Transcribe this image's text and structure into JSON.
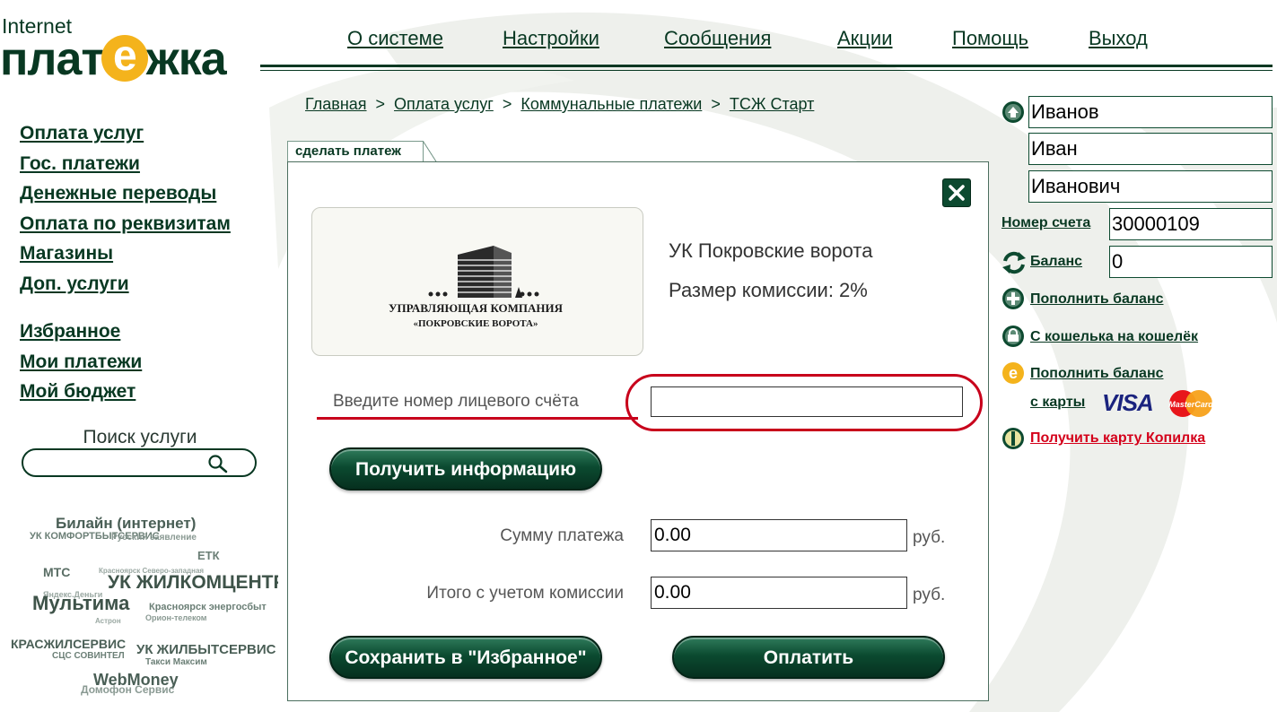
{
  "logo": {
    "line1": "Internet",
    "line2_pre": "плат",
    "line2_badge": "е",
    "line2_post": "жка"
  },
  "top_menu": [
    {
      "label": "О системе"
    },
    {
      "label": "Настройки"
    },
    {
      "label": "Сообщения"
    },
    {
      "label": "Акции"
    },
    {
      "label": "Помощь"
    },
    {
      "label": "Выход"
    }
  ],
  "breadcrumb": {
    "items": [
      "Главная",
      "Оплата услуг",
      "Коммунальные платежи",
      "ТСЖ Старт"
    ],
    "separator": ">"
  },
  "left_nav": {
    "group1": [
      "Оплата услуг",
      "Гос. платежи",
      "Денежные переводы",
      "Оплата по реквизитам",
      "Магазины",
      "Доп. услуги"
    ],
    "group2": [
      "Избранное",
      "Мои платежи",
      "Мой бюджет"
    ]
  },
  "search": {
    "label": "Поиск услуги",
    "value": ""
  },
  "tag_cloud": [
    {
      "text": "Билайн (интернет)",
      "size": 17,
      "color": "#4a5f56"
    },
    {
      "text": "УК КОМФОРТБЫТСЕРВИС",
      "size": 11,
      "color": "#6b7f76"
    },
    {
      "text": "Русский заявление",
      "size": 10,
      "color": "#8a9a93"
    },
    {
      "text": "ЕТК",
      "size": 13,
      "color": "#6b7f76"
    },
    {
      "text": "МТС",
      "size": 14,
      "color": "#5a6e65"
    },
    {
      "text": "Красноярск Северо-западная",
      "size": 8,
      "color": "#9aa8a2"
    },
    {
      "text": "УК ЖИЛКОМЦЕНТР",
      "size": 21,
      "color": "#3e5349"
    },
    {
      "text": "Яндекс.Деньги",
      "size": 9,
      "color": "#9aa8a2"
    },
    {
      "text": "Мультима",
      "size": 22,
      "color": "#3e5349"
    },
    {
      "text": "Красноярск энергосбыт",
      "size": 11,
      "color": "#6b7f76"
    },
    {
      "text": "Орион-телеком",
      "size": 9,
      "color": "#8a9a93"
    },
    {
      "text": "Астрон",
      "size": 8,
      "color": "#9aa8a2"
    },
    {
      "text": "КРАСЖИЛСЕРВИС",
      "size": 14,
      "color": "#4a5f56"
    },
    {
      "text": "УК ЖИЛБЫТСЕРВИС",
      "size": 15,
      "color": "#4a5f56"
    },
    {
      "text": "СЦС СОВИНТЕЛ",
      "size": 10,
      "color": "#6b7f76"
    },
    {
      "text": "Такси Максим",
      "size": 10,
      "color": "#6b7f76"
    },
    {
      "text": "WebMoney",
      "size": 18,
      "color": "#4a5f56"
    },
    {
      "text": "Домофон Сервис",
      "size": 12,
      "color": "#8a9a93"
    }
  ],
  "panel": {
    "tab_label": "сделать платеж",
    "provider_logo_line1": "УПРАВЛЯЮЩАЯ КОМПАНИЯ",
    "provider_logo_line2": "«ПОКРОВСКИЕ ВОРОТА»",
    "provider_name": "УК Покровские ворота",
    "commission": "Размер комиссии: 2%",
    "account_label": "Введите номер лицевого счёта",
    "account_value": "",
    "get_info_button": "Получить информацию",
    "sum_label": "Сумму платежа",
    "sum_value": "0.00",
    "total_label": "Итого с учетом комиссии",
    "total_value": "0.00",
    "currency": "руб.",
    "save_favorite_button": "Сохранить в \"Избранное\"",
    "pay_button": "Оплатить"
  },
  "user": {
    "last_name": "Иванов",
    "first_name": "Иван",
    "patronymic": "Иванович",
    "account_label": "Номер счета",
    "account_number": "30000109",
    "balance_label": "Баланс",
    "balance": "0"
  },
  "side_links": {
    "top_up": "Пополнить баланс",
    "wallet_to_wallet": "С кошелька на кошелёк",
    "top_up_card_line1": "Пополнить баланс",
    "top_up_card_line2": "с карты",
    "visa": "VISA",
    "mastercard": "MasterCard",
    "get_card": "Получить карту Копилка"
  },
  "colors": {
    "brand_green": "#083822",
    "accent_yellow": "#f4b31c",
    "highlight_red": "#c8001b"
  }
}
